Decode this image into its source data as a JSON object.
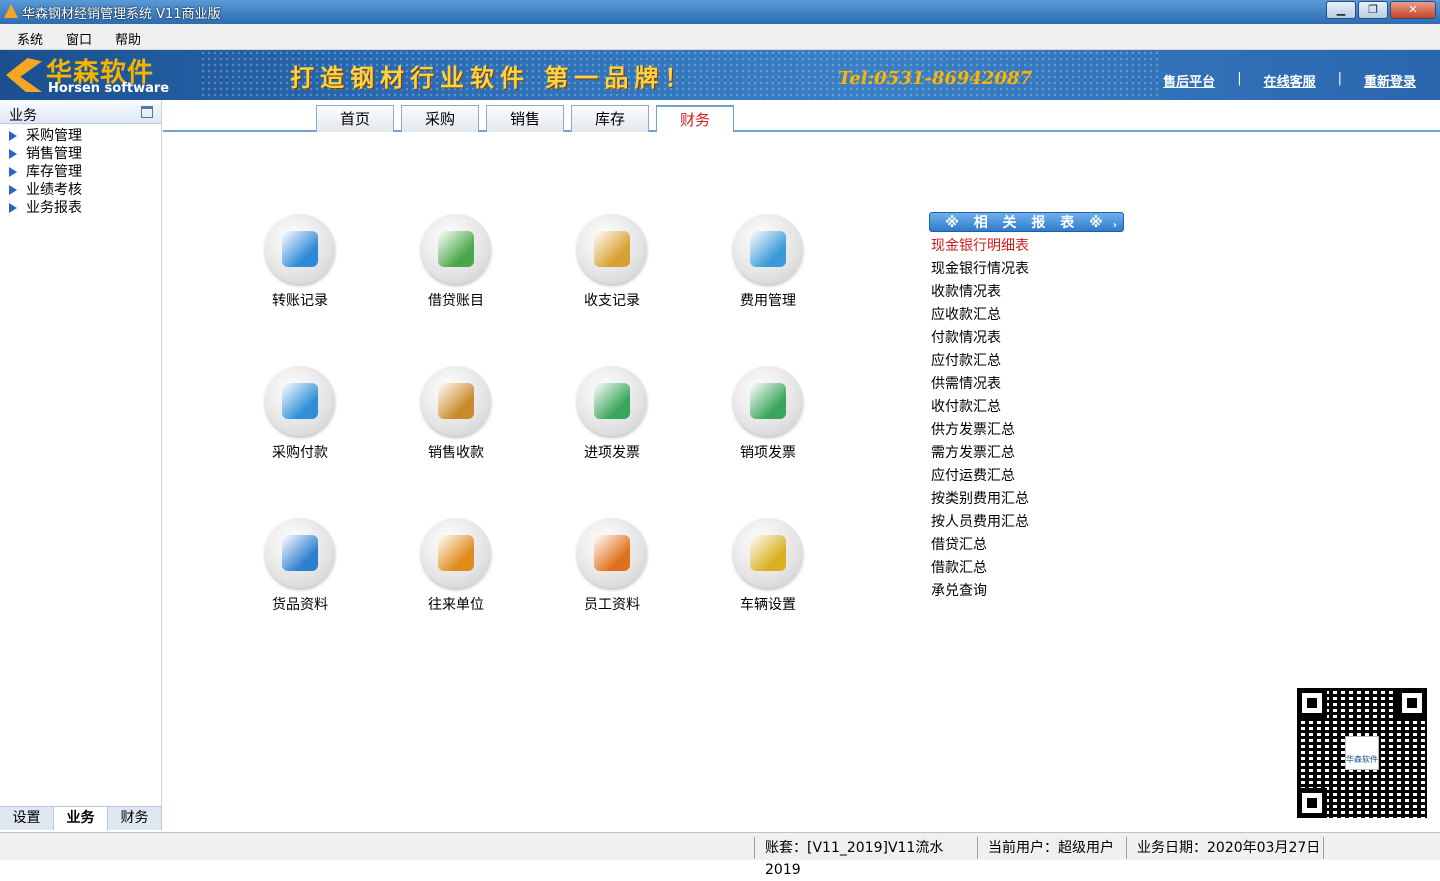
{
  "window": {
    "title": "华森钢材经销管理系统 V11商业版",
    "minimize_label": "▁",
    "maximize_label": "❐",
    "close_label": "✕"
  },
  "menu": [
    "系统",
    "窗口",
    "帮助"
  ],
  "banner": {
    "logo_cn": "华森软件",
    "logo_en": "Horsen software",
    "slogan": "打造钢材行业软件 第一品牌！",
    "tel": "Tel:0531-86942087",
    "links": [
      "售后平台",
      "在线客服",
      "重新登录"
    ],
    "separator": "|"
  },
  "sidebar": {
    "title": "业务",
    "items": [
      "采购管理",
      "销售管理",
      "库存管理",
      "业绩考核",
      "业务报表"
    ],
    "bottom_tabs": [
      "设置",
      "业务",
      "财务"
    ],
    "active_tab": "业务"
  },
  "tabs": [
    "首页",
    "采购",
    "销售",
    "库存",
    "财务"
  ],
  "active_tab": "财务",
  "tiles": [
    {
      "label": "转账记录",
      "icon": "bank-transfer-icon",
      "color": "#2e8ad8"
    },
    {
      "label": "借贷账目",
      "icon": "loan-ledger-icon",
      "color": "#4aa84a"
    },
    {
      "label": "收支记录",
      "icon": "income-expense-icon",
      "color": "#d8a030"
    },
    {
      "label": "费用管理",
      "icon": "expense-management-icon",
      "color": "#3a9ad8"
    },
    {
      "label": "采购付款",
      "icon": "purchase-payment-icon",
      "color": "#2f8fd6"
    },
    {
      "label": "销售收款",
      "icon": "sales-receipt-icon",
      "color": "#c98a2a"
    },
    {
      "label": "进项发票",
      "icon": "input-invoice-icon",
      "color": "#3aa65a"
    },
    {
      "label": "销项发票",
      "icon": "output-invoice-icon",
      "color": "#3aa65a"
    },
    {
      "label": "货品资料",
      "icon": "goods-data-icon",
      "color": "#2f7fd0"
    },
    {
      "label": "往来单位",
      "icon": "partner-folder-icon",
      "color": "#e08a1a"
    },
    {
      "label": "员工资料",
      "icon": "staff-files-icon",
      "color": "#e0701a"
    },
    {
      "label": "车辆设置",
      "icon": "vehicle-truck-icon",
      "color": "#d8b020"
    }
  ],
  "reports": {
    "title": "※ 相 关 报 表 ※",
    "chevron": "›",
    "items": [
      "现金银行明细表",
      "现金银行情况表",
      "收款情况表",
      "应收款汇总",
      "付款情况表",
      "应付款汇总",
      "供需情况表",
      "收付款汇总",
      "供方发票汇总",
      "需方发票汇总",
      "应付运费汇总",
      "按类别费用汇总",
      "按人员费用汇总",
      "借贷汇总",
      "借款汇总",
      "承兑查询"
    ],
    "active_item": "现金银行明细表"
  },
  "qr": {
    "caption": "华森软件"
  },
  "status": {
    "account": "账套：[V11_2019]V11流水2019",
    "user": "当前用户：超级用户",
    "date": "业务日期：2020年03月27日"
  }
}
